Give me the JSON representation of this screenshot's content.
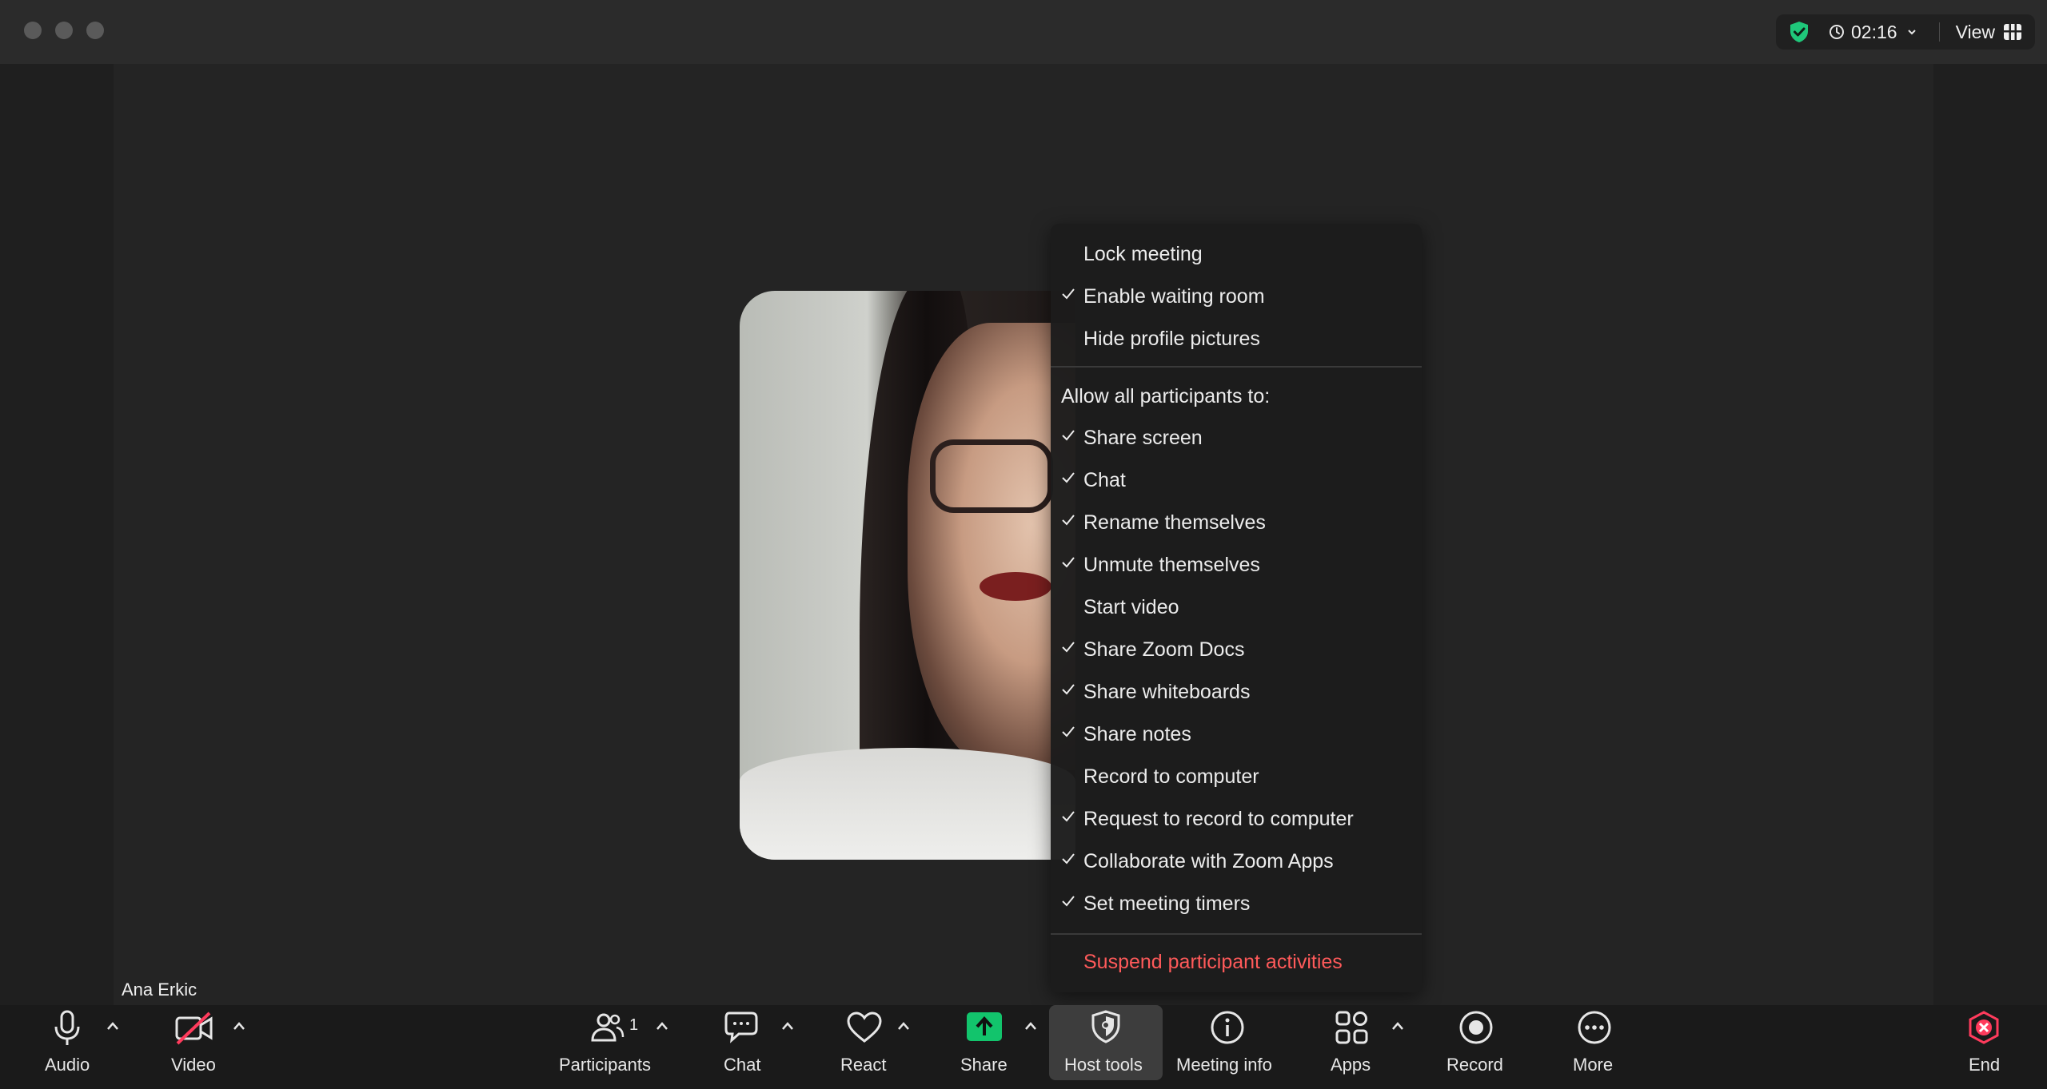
{
  "window": {
    "timer": "02:16",
    "view_label": "View"
  },
  "participant": {
    "name": "Ana Erkic"
  },
  "host_menu": {
    "top_items": [
      {
        "label": "Lock meeting",
        "checked": false
      },
      {
        "label": "Enable waiting room",
        "checked": true
      },
      {
        "label": "Hide profile pictures",
        "checked": false
      }
    ],
    "section_heading": "Allow all participants to:",
    "allow_items": [
      {
        "label": "Share screen",
        "checked": true
      },
      {
        "label": "Chat",
        "checked": true
      },
      {
        "label": "Rename themselves",
        "checked": true
      },
      {
        "label": "Unmute themselves",
        "checked": true
      },
      {
        "label": "Start video",
        "checked": false
      },
      {
        "label": "Share Zoom Docs",
        "checked": true
      },
      {
        "label": "Share whiteboards",
        "checked": true
      },
      {
        "label": "Share notes",
        "checked": true
      },
      {
        "label": "Record to computer",
        "checked": false
      },
      {
        "label": "Request to record to computer",
        "checked": true
      },
      {
        "label": "Collaborate with Zoom Apps",
        "checked": true
      },
      {
        "label": "Set meeting timers",
        "checked": true
      }
    ],
    "danger_item": "Suspend participant activities"
  },
  "toolbar": {
    "audio": "Audio",
    "video": "Video",
    "participants": "Participants",
    "participants_count": "1",
    "chat": "Chat",
    "react": "React",
    "share": "Share",
    "host_tools": "Host tools",
    "meeting_info": "Meeting info",
    "apps": "Apps",
    "record": "Record",
    "more": "More",
    "end": "End"
  },
  "colors": {
    "shield": "#1fc77a",
    "share": "#12c46c",
    "danger": "#ff5a5a",
    "end": "#ff3b5c"
  }
}
